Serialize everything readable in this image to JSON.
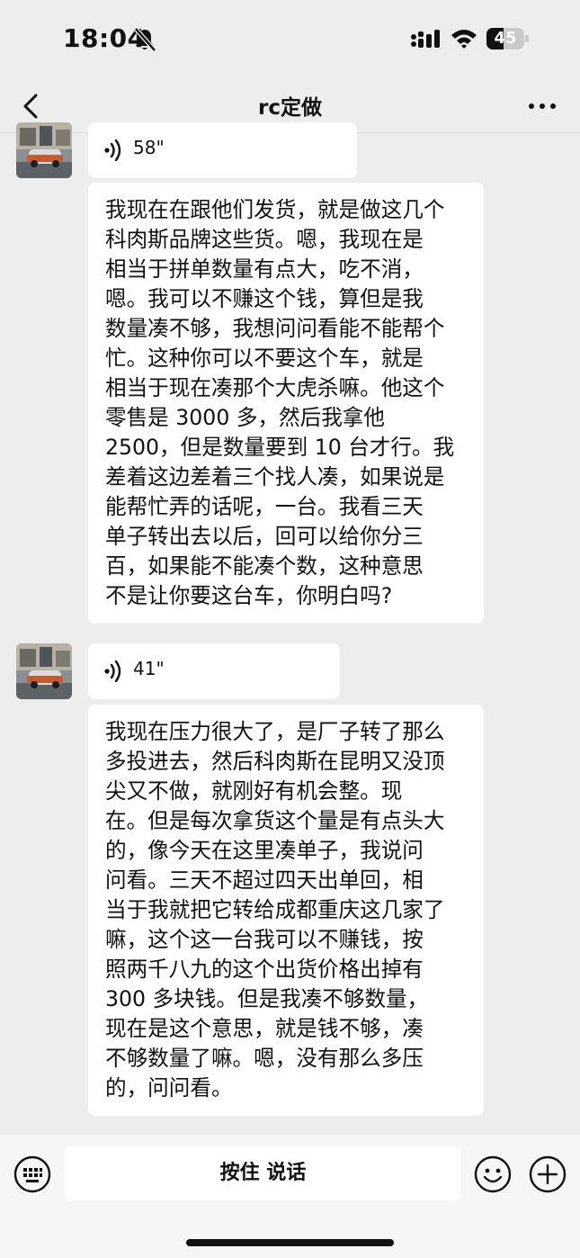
{
  "status_bar": {
    "time": "18:04",
    "battery_level": "45",
    "battery_fraction": 0.45,
    "icons": [
      "bell-slash-icon",
      "signal-icon",
      "wifi-icon",
      "battery-icon"
    ]
  },
  "nav": {
    "title": "rc定做",
    "back_icon": "chevron-left-icon",
    "more_icon": "ellipsis-icon"
  },
  "messages": [
    {
      "type": "voice",
      "duration": "58\""
    },
    {
      "type": "text",
      "text": "我现在在跟他们发货，就是做这几个\n科肉斯品牌这些货。嗯，我现在是\n相当于拼单数量有点大，吃不消，\n嗯。我可以不赚这个钱，算但是我\n数量凑不够，我想问问看能不能帮个\n忙。这种你可以不要这个车，就是\n相当于现在凑那个大虎杀嘛。他这个\n零售是 3000 多，然后我拿他\n 2500，但是数量要到 10 台才行。我\n差着这边差着三个找人凑，如果说是\n能帮忙弄的话呢，一台。我看三天\n单子转出去以后，回可以给你分三\n百，如果能不能凑个数，这种意思\n不是让你要这台车，你明白吗?"
    },
    {
      "type": "voice",
      "duration": "41\""
    },
    {
      "type": "text",
      "text": "我现在压力很大了，是厂子转了那么\n多投进去，然后科肉斯在昆明又没顶\n尖又不做，就刚好有机会整。现\n在。但是每次拿货这个量是有点头大\n的，像今天在这里凑单子，我说问\n问看。三天不超过四天出单回，相\n当于我就把它转给成都重庆这几家了\n嘛，这个这一台我可以不赚钱，按\n照两千八九的这个出货价格出掉有\n 300 多块钱。但是我凑不够数量，\n现在是这个意思，就是钱不够，凑\n不够数量了嘛。嗯，没有那么多压\n的，问问看。"
    }
  ],
  "input_bar": {
    "talk_label": "按住 说话",
    "icons": [
      "keyboard-icon",
      "emoji-icon",
      "plus-icon"
    ]
  },
  "colors": {
    "background": "#ededed",
    "bubble": "#ffffff",
    "input_bar": "#f6f6f6"
  }
}
